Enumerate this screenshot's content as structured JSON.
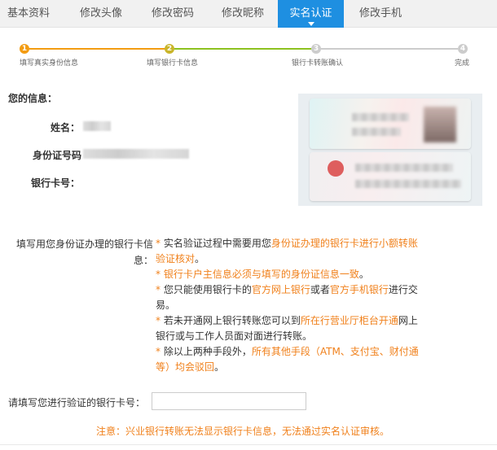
{
  "tabs": [
    {
      "label": "基本资料",
      "active": false
    },
    {
      "label": "修改头像",
      "active": false
    },
    {
      "label": "修改密码",
      "active": false
    },
    {
      "label": "修改昵称",
      "active": false
    },
    {
      "label": "实名认证",
      "active": true
    },
    {
      "label": "修改手机",
      "active": false
    }
  ],
  "steps": [
    {
      "num": "1",
      "label": "填写真实身份信息",
      "state": "done"
    },
    {
      "num": "2",
      "label": "填写银行卡信息",
      "state": "current"
    },
    {
      "num": "3",
      "label": "银行卡转账确认",
      "state": "pending"
    },
    {
      "num": "4",
      "label": "完成",
      "state": "pending"
    }
  ],
  "colors": {
    "accent": "#1e8fe1",
    "orange": "#f0801b",
    "step_done": "#f39c12",
    "step_current": "#8dc21f",
    "step_pending": "#cccccc"
  },
  "info": {
    "title": "您的信息：",
    "name_label": "姓名：",
    "id_label": "身份证号码",
    "bank_label": "银行卡号："
  },
  "instructions": {
    "label": "填写用您身份证办理的银行卡信息：",
    "rules": [
      [
        "* ",
        "实名验证过程中需要用您",
        "身份证办理的银行卡进行小额转账验证核对",
        "。"
      ],
      [
        "* ",
        "",
        "银行卡户主信息必须与填写的身份证信息一致",
        "。"
      ],
      [
        "* ",
        "您只能使用银行卡的",
        "官方网上银行",
        "或者",
        "官方手机银行",
        "进行交易。"
      ],
      [
        "* ",
        "若未开通网上银行转账您可以到",
        "所在行营业厅柜台开通",
        "网上银行或与工作人员面对面进行转账。"
      ],
      [
        "* ",
        "除以上两种手段外，",
        "所有其他手段（ATM、支付宝、财付通等）均会驳回",
        "。"
      ]
    ]
  },
  "card_input": {
    "label": "请填写您进行验证的银行卡号：",
    "value": "",
    "placeholder": ""
  },
  "notice": "注意：兴业银行转账无法显示银行卡信息，无法通过实名认证审核。"
}
